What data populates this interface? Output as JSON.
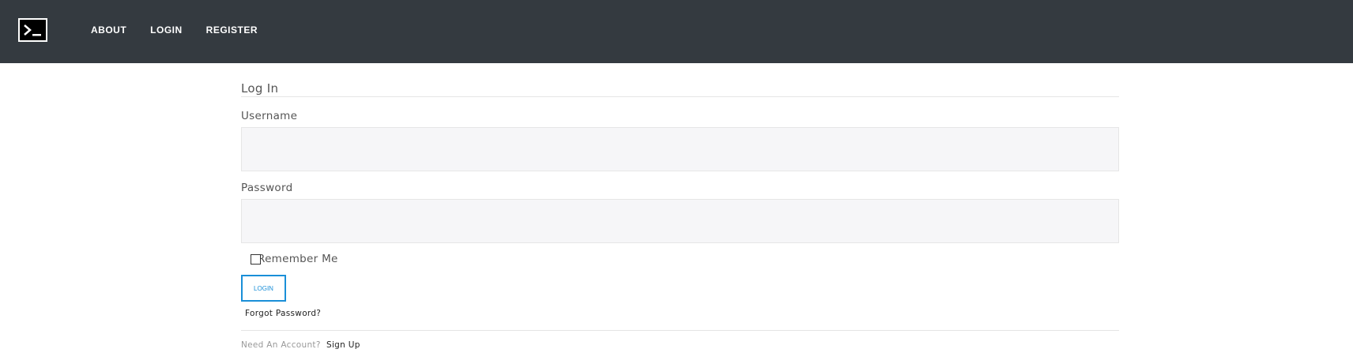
{
  "nav": {
    "logo_icon": "terminal-icon",
    "links": [
      "ABOUT",
      "LOGIN",
      "REGISTER"
    ]
  },
  "form": {
    "legend": "Log In",
    "username_label": "Username",
    "username_value": "",
    "password_label": "Password",
    "password_value": "",
    "remember_label": "Remember Me",
    "remember_checked": false,
    "login_button": "LOGIN",
    "forgot_link": "Forgot Password?",
    "need_account_text": "Need An Account?",
    "signup_link": "Sign Up"
  },
  "colors": {
    "navbar": "#343a40",
    "button_accent": "#1a8fd8",
    "input_bg": "#f6f6f8"
  }
}
